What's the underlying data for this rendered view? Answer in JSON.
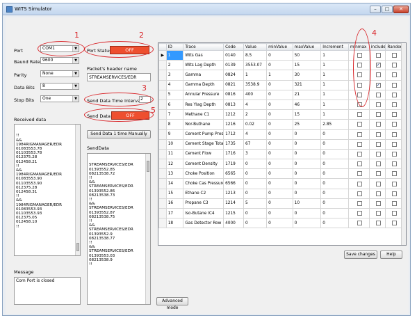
{
  "window": {
    "title": "WITS Simulator",
    "min": "–",
    "max": "□",
    "close": "✕"
  },
  "left": {
    "port_label": "Port",
    "port_value": "COM1",
    "baud_label": "Baund Rate",
    "baud_value": "9600",
    "parity_label": "Parity",
    "parity_value": "None",
    "databits_label": "Data Bits",
    "databits_value": "8",
    "stopbits_label": "Stop Bits",
    "stopbits_value": "One",
    "received_label": "Received data",
    "received_text": "!!\n&&\n1984RIGMANAGER/EDR\n01083553.78\n01103553.78\n012375.28\n012458.21\n!!\n&&\n1984RIGMANAGER/EDR\n01083553.90\n01103553.90\n012375.28\n012458.31\n!!\n&&\n1984RIGMANAGER/EDR\n01083553.93\n01103553.93\n012375.05\n012458.10\n!!",
    "message_label": "Message",
    "message_text": "Com Port is closed"
  },
  "middle": {
    "port_status_label": "Port Status:",
    "port_status_value": "OFF",
    "header_name_label": "Packet's header name",
    "header_name_value": "STREAMSERVICES/EDR",
    "interval_label": "Send Data Time Interval, sec",
    "interval_value": "2",
    "send_data_label": "Send Data",
    "send_data_value": "OFF",
    "send_once_button": "Send Data 1 time Manually",
    "senddata_label": "SendData",
    "senddata_text": "STREAMSERVICES/EDR\n01393552.85\n08213538.72\n!!\n&&\nSTREAMSERVICES/EDR\n01393552.86\n08213538.73\n!!\n&&\nSTREAMSERVICES/EDR\n01393552.87\n08213538.75\n!!\n&&\nSTREAMSERVICES/EDR\n01393552.9\n08213538.77\n!!\n&&\nSTREAMSERVICES/EDR\n01393553.03\n08213538.9\n!!",
    "advanced_button": "Advanced mode"
  },
  "grid": {
    "columns": [
      "ID",
      "Trace",
      "Code",
      "Value",
      "minValue",
      "maxValue",
      "Increment",
      "minmax",
      "include",
      "Random"
    ],
    "rows": [
      {
        "id": "1",
        "trace": "Wits Gas",
        "code": "0140",
        "value": "8.5",
        "min": "0",
        "max": "50",
        "inc": "1",
        "minmax": false,
        "include": false,
        "random": false
      },
      {
        "id": "2",
        "trace": "Wits Lag Depth",
        "code": "0139",
        "value": "3553.07",
        "min": "0",
        "max": "15",
        "inc": "1",
        "minmax": false,
        "include": true,
        "random": false
      },
      {
        "id": "3",
        "trace": "Gamma",
        "code": "0824",
        "value": "1",
        "min": "1",
        "max": "30",
        "inc": "1",
        "minmax": false,
        "include": false,
        "random": false
      },
      {
        "id": "4",
        "trace": "Gamma Depth",
        "code": "0821",
        "value": "3538.9",
        "min": "0",
        "max": "321",
        "inc": "1",
        "minmax": false,
        "include": true,
        "random": false
      },
      {
        "id": "5",
        "trace": "Annular Pressure",
        "code": "0816",
        "value": "400",
        "min": "0",
        "max": "21",
        "inc": "1",
        "minmax": false,
        "include": false,
        "random": false
      },
      {
        "id": "6",
        "trace": "Res Ylag Depth",
        "code": "0813",
        "value": "4",
        "min": "0",
        "max": "46",
        "inc": "1",
        "minmax": false,
        "include": false,
        "random": false
      },
      {
        "id": "7",
        "trace": "Methane C1",
        "code": "1212",
        "value": "2",
        "min": "0",
        "max": "15",
        "inc": "1",
        "minmax": false,
        "include": false,
        "random": false
      },
      {
        "id": "8",
        "trace": "Nor-Buthane",
        "code": "1216",
        "value": "0.02",
        "min": "0",
        "max": "25",
        "inc": "2.85",
        "minmax": false,
        "include": false,
        "random": false
      },
      {
        "id": "9",
        "trace": "Cement Pump Press",
        "code": "1712",
        "value": "4",
        "min": "0",
        "max": "0",
        "inc": "0",
        "minmax": false,
        "include": false,
        "random": false
      },
      {
        "id": "10",
        "trace": "Cement Stage Total",
        "code": "1735",
        "value": "67",
        "min": "0",
        "max": "0",
        "inc": "0",
        "minmax": false,
        "include": false,
        "random": false
      },
      {
        "id": "11",
        "trace": "Cement Flow",
        "code": "1716",
        "value": "3",
        "min": "0",
        "max": "0",
        "inc": "0",
        "minmax": false,
        "include": false,
        "random": false
      },
      {
        "id": "12",
        "trace": "Cement Density",
        "code": "1719",
        "value": "0",
        "min": "0",
        "max": "0",
        "inc": "0",
        "minmax": false,
        "include": false,
        "random": false
      },
      {
        "id": "13",
        "trace": "Choke Position",
        "code": "6565",
        "value": "0",
        "min": "0",
        "max": "0",
        "inc": "0",
        "minmax": false,
        "include": false,
        "random": false
      },
      {
        "id": "14",
        "trace": "Choke Cas Pressure",
        "code": "6566",
        "value": "0",
        "min": "0",
        "max": "0",
        "inc": "0",
        "minmax": false,
        "include": false,
        "random": false
      },
      {
        "id": "15",
        "trace": "Ethane C2",
        "code": "1213",
        "value": "0",
        "min": "0",
        "max": "0",
        "inc": "0",
        "minmax": false,
        "include": false,
        "random": false
      },
      {
        "id": "16",
        "trace": "Propane C3",
        "code": "1214",
        "value": "5",
        "min": "0",
        "max": "10",
        "inc": "0",
        "minmax": false,
        "include": false,
        "random": false
      },
      {
        "id": "17",
        "trace": "Iso-Butane IC4",
        "code": "1215",
        "value": "0",
        "min": "0",
        "max": "0",
        "inc": "0",
        "minmax": false,
        "include": false,
        "random": false
      },
      {
        "id": "18",
        "trace": "Gas Detector Row",
        "code": "4000",
        "value": "0",
        "min": "0",
        "max": "0",
        "inc": "0",
        "minmax": false,
        "include": false,
        "random": false
      }
    ]
  },
  "buttons": {
    "save": "Save changes",
    "help": "Help"
  },
  "annotations": {
    "n1": "1",
    "n2": "2",
    "n3": "3",
    "n4": "4",
    "n5": "5"
  },
  "colors": {
    "status_off": "#ee4f2f",
    "annotation": "#d9262a",
    "selection": "#3399ff"
  }
}
